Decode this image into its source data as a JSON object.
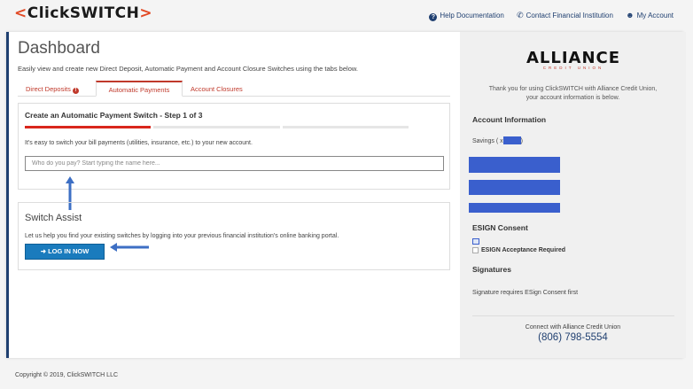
{
  "header": {
    "logo_text": "ClickSWITCH",
    "links": {
      "help": "Help Documentation",
      "contact": "Contact Financial Institution",
      "account": "My Account"
    }
  },
  "main": {
    "title": "Dashboard",
    "subtitle": "Easily view and create new Direct Deposit, Automatic Payment and Account Closure Switches using the tabs below.",
    "tabs": [
      {
        "label": "Direct Deposits",
        "badge": "!"
      },
      {
        "label": "Automatic Payments"
      },
      {
        "label": "Account Closures"
      }
    ],
    "autopay": {
      "title": "Create an Automatic Payment Switch - Step 1 of 3",
      "step": 1,
      "total_steps": 3,
      "description": "It's easy to switch your bill payments (utilities, insurance, etc.) to your new account.",
      "input_placeholder": "Who do you pay? Start typing the name here..."
    },
    "assist": {
      "title": "Switch Assist",
      "description": "Let us help you find your existing switches by logging into your previous financial institution's online banking portal.",
      "button_label": "LOG IN NOW"
    }
  },
  "sidebar": {
    "logo_name": "ALLIANCE",
    "logo_sub": "CREDIT UNION",
    "thanks": "Thank you for using ClickSWITCH with Alliance Credit Union, your account information is below.",
    "account_title": "Account Information",
    "savings_prefix": "Savings ( x",
    "savings_suffix": ")",
    "esign_title": "ESIGN Consent",
    "esign_label": "ESIGN Acceptance Required",
    "sig_title": "Signatures",
    "sig_text": "Signature requires ESign Consent first",
    "connect": "Connect with Alliance Credit Union",
    "phone": "(806) 798-5554"
  },
  "footer": {
    "copyright": "Copyright © 2019, ClickSWITCH LLC"
  },
  "colors": {
    "brand_navy": "#1f3f70",
    "accent_red": "#d9261c",
    "button_blue": "#1a7bbd",
    "redaction_blue": "#3a5fcd"
  }
}
